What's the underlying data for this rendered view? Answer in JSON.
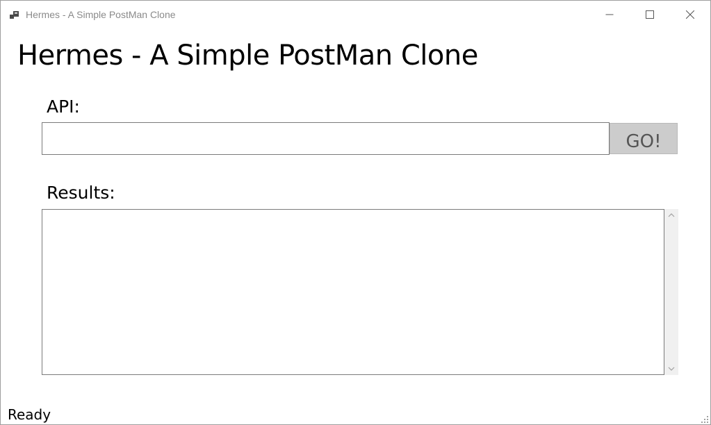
{
  "window": {
    "title": "Hermes - A Simple PostMan Clone",
    "icon": "app-window-icon",
    "controls": [
      "minimize-icon",
      "maximize-icon",
      "close-icon"
    ]
  },
  "main": {
    "heading": "Hermes - A Simple PostMan Clone",
    "api_label": "API:",
    "api_input_value": "",
    "go_button_label": "GO!",
    "results_label": "Results:",
    "results_value": ""
  },
  "status_bar": {
    "text": "Ready"
  },
  "colors": {
    "button_bg": "#cccccc",
    "button_text": "#555555",
    "title_text": "#8a8a8a",
    "border": "#7a7a7a"
  }
}
